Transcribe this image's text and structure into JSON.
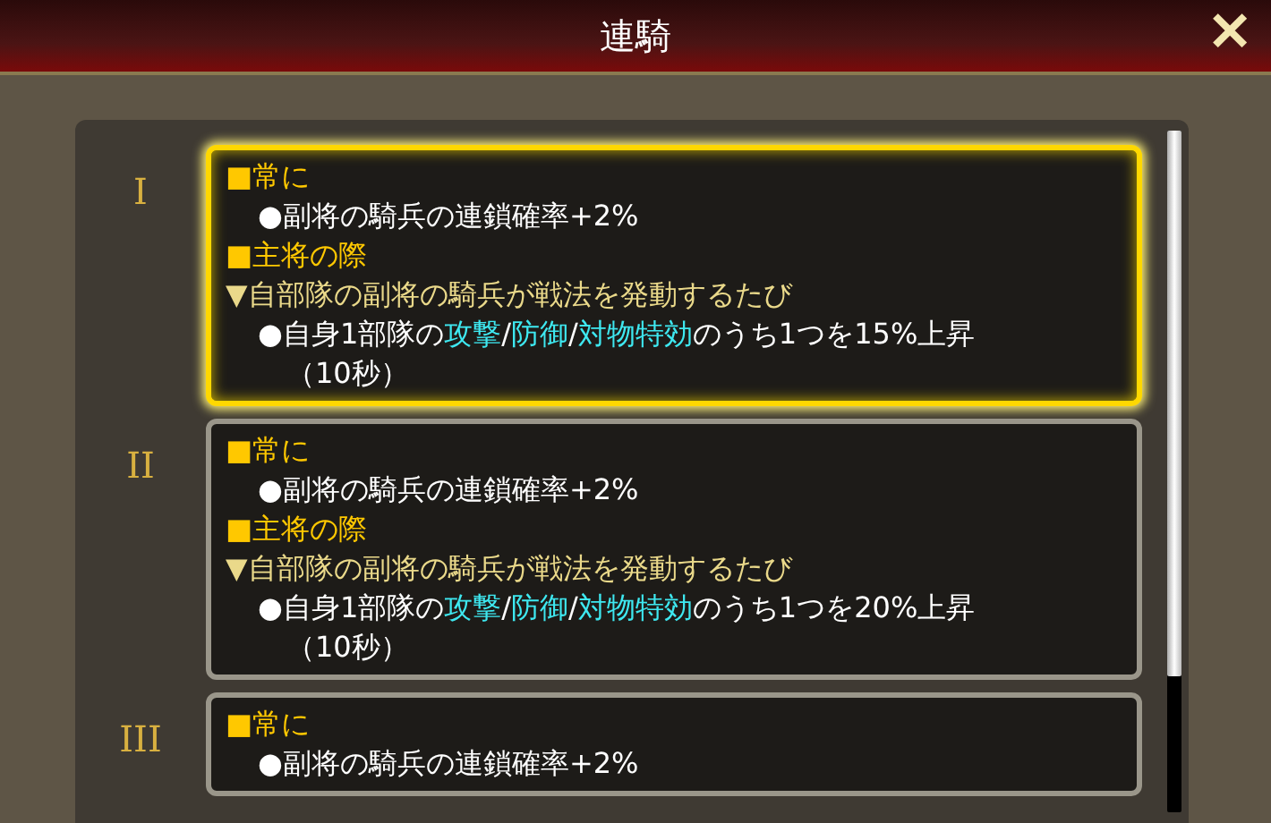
{
  "window": {
    "title": "連騎",
    "close": "✕"
  },
  "levels": [
    {
      "numeral": "I",
      "selected": true,
      "lines": [
        {
          "kind": "condition",
          "segments": [
            {
              "text": "■常に",
              "highlight": false
            }
          ]
        },
        {
          "kind": "effect",
          "segments": [
            {
              "text": "●副将の騎兵の連鎖確率+2%",
              "highlight": false
            }
          ]
        },
        {
          "kind": "condition",
          "segments": [
            {
              "text": "■主将の際",
              "highlight": false
            }
          ]
        },
        {
          "kind": "trigger",
          "segments": [
            {
              "text": "▼自部隊の副将の騎兵が戦法を発動するたび",
              "highlight": false
            }
          ]
        },
        {
          "kind": "effect",
          "segments": [
            {
              "text": "●自身1部隊の",
              "highlight": false
            },
            {
              "text": "攻撃",
              "highlight": true
            },
            {
              "text": "/",
              "highlight": false
            },
            {
              "text": "防御",
              "highlight": true
            },
            {
              "text": "/",
              "highlight": false
            },
            {
              "text": "対物特効",
              "highlight": true
            },
            {
              "text": "のうち1つを15%上昇（10秒）",
              "highlight": false
            }
          ]
        }
      ]
    },
    {
      "numeral": "II",
      "selected": false,
      "lines": [
        {
          "kind": "condition",
          "segments": [
            {
              "text": "■常に",
              "highlight": false
            }
          ]
        },
        {
          "kind": "effect",
          "segments": [
            {
              "text": "●副将の騎兵の連鎖確率+2%",
              "highlight": false
            }
          ]
        },
        {
          "kind": "condition",
          "segments": [
            {
              "text": "■主将の際",
              "highlight": false
            }
          ]
        },
        {
          "kind": "trigger",
          "segments": [
            {
              "text": "▼自部隊の副将の騎兵が戦法を発動するたび",
              "highlight": false
            }
          ]
        },
        {
          "kind": "effect",
          "segments": [
            {
              "text": "●自身1部隊の",
              "highlight": false
            },
            {
              "text": "攻撃",
              "highlight": true
            },
            {
              "text": "/",
              "highlight": false
            },
            {
              "text": "防御",
              "highlight": true
            },
            {
              "text": "/",
              "highlight": false
            },
            {
              "text": "対物特効",
              "highlight": true
            },
            {
              "text": "のうち1つを20%上昇（10秒）",
              "highlight": false
            }
          ]
        }
      ]
    },
    {
      "numeral": "III",
      "selected": false,
      "lines": [
        {
          "kind": "condition",
          "segments": [
            {
              "text": "■常に",
              "highlight": false
            }
          ]
        },
        {
          "kind": "effect",
          "segments": [
            {
              "text": "●副将の騎兵の連鎖確率+2%",
              "highlight": false
            }
          ]
        }
      ]
    }
  ]
}
